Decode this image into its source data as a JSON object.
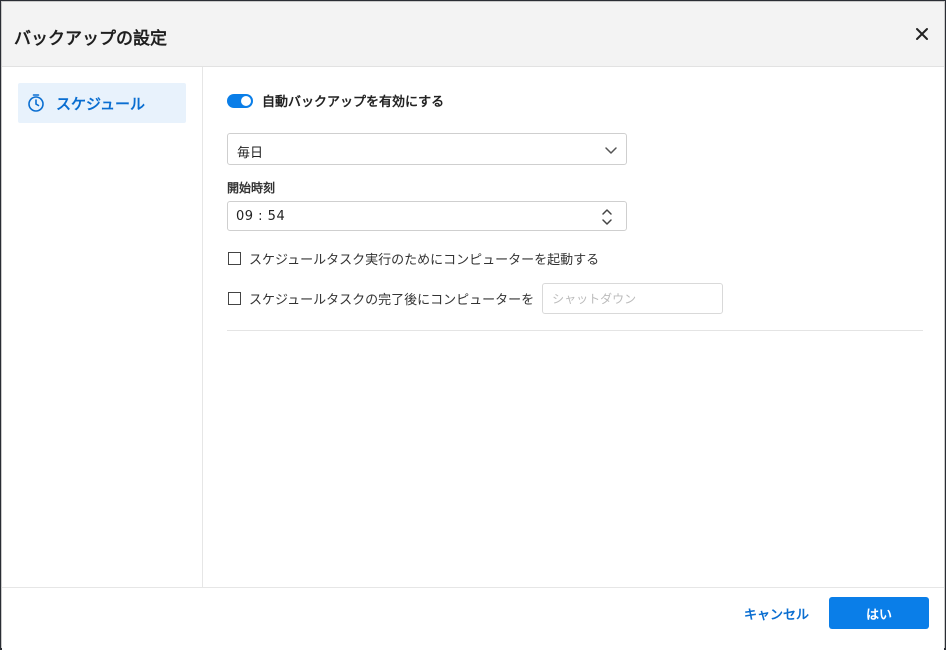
{
  "dialog": {
    "title": "バックアップの設定"
  },
  "sidebar": {
    "items": [
      {
        "label": "スケジュール",
        "icon": "stopwatch-icon",
        "active": true
      }
    ]
  },
  "schedule": {
    "auto_backup_label": "自動バックアップを有効にする",
    "auto_backup_enabled": true,
    "frequency_value": "毎日",
    "start_time_label": "開始時刻",
    "start_time_value": "09 : 54",
    "wake_computer_label": "スケジュールタスク実行のためにコンピューターを起動する",
    "wake_computer_checked": false,
    "after_task_label": "スケジュールタスクの完了後にコンピューターを",
    "after_task_checked": false,
    "after_task_action_placeholder": "シャットダウン"
  },
  "footer": {
    "cancel_label": "キャンセル",
    "ok_label": "はい"
  },
  "colors": {
    "accent": "#0a7ee8",
    "link": "#0a6ed1",
    "nav_active_bg": "#e8f2fc"
  }
}
